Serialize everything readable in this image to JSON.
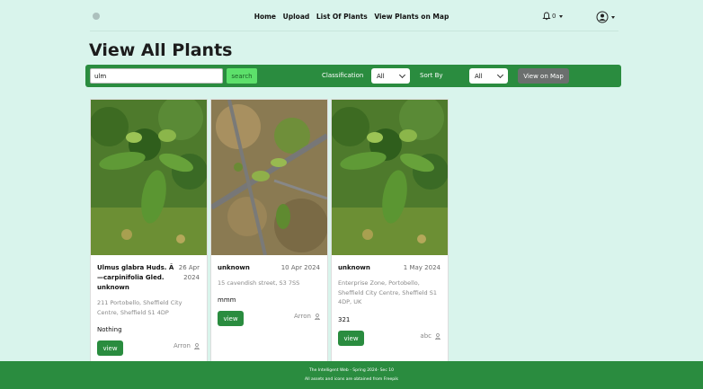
{
  "nav": {
    "links": [
      "Home",
      "Upload",
      "List Of Plants",
      "View Plants on Map"
    ],
    "notifications_count": "0"
  },
  "page": {
    "title": "View All Plants"
  },
  "filters": {
    "search_value": "ulm",
    "search_button": "search",
    "classification_label": "Classification",
    "classification_value": "All",
    "sort_label": "Sort By",
    "sort_value": "All",
    "map_button": "View on Map"
  },
  "cards": [
    {
      "title": "Ulmus glabra Huds. Ã—carpinifolia Gled. unknown",
      "date": "26 Apr 2024",
      "address": "211 Portobello, Sheffield City Centre, Sheffield S1 4DP",
      "description": "Nothing",
      "view": "view",
      "author": "Arron"
    },
    {
      "title": "unknown",
      "date": "10 Apr 2024",
      "address": "15 cavendish street, S3 7SS",
      "description": "mmm",
      "view": "view",
      "author": "Arron"
    },
    {
      "title": "unknown",
      "date": "1 May 2024",
      "address": "Enterprise Zone, Portobello, Sheffield City Centre, Sheffield S1 4DP, UK",
      "description": "321",
      "view": "view",
      "author": "abc"
    }
  ],
  "footer": {
    "line1": "The Intelligent Web - Spring 2024- Sec 10",
    "line2": "All assets and icons are obtained from Freepik"
  },
  "colors": {
    "accent": "#2a8c3f",
    "background": "#d9f4ec",
    "search_button": "#5de06b"
  }
}
